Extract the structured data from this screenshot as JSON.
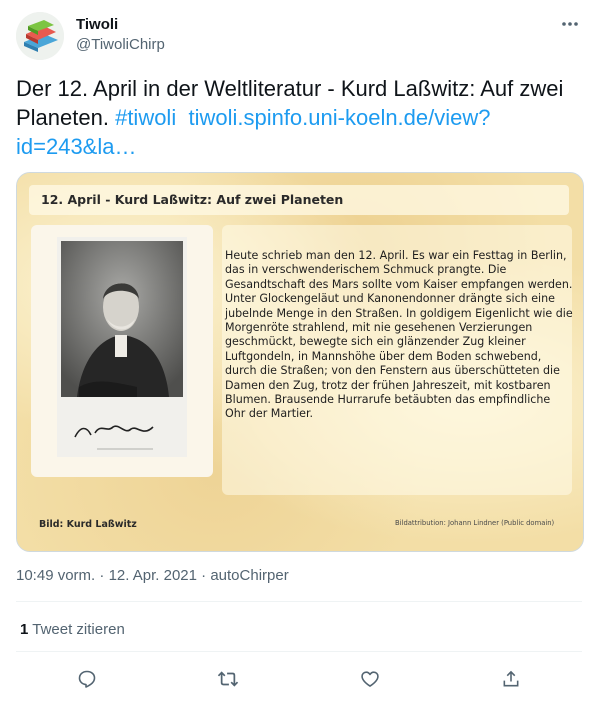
{
  "author": {
    "name": "Tiwoli",
    "handle": "@TiwoliChirp"
  },
  "tweet": {
    "text": "Der 12. April in der Weltliteratur - Kurd Laßwitz: Auf zwei Planeten. ",
    "hashtag": "#tiwoli",
    "link": "tiwoli.spinfo.uni-koeln.de/view?id=243&la…"
  },
  "media": {
    "title": "12. April - Kurd Laßwitz: Auf zwei Planeten",
    "story": "Heute schrieb man den 12. April. Es war ein Festtag in Berlin, das in verschwenderischem Schmuck prangte. Die Gesandtschaft des Mars sollte vom Kaiser empfangen werden. Unter Glockengeläut und Kanonendonner drängte sich eine jubelnde Menge in den Straßen. In goldigem Eigenlicht wie die Morgenröte strahlend, mit nie gesehenen Verzierungen geschmückt, bewegte sich ein glänzender Zug kleiner Luftgondeln, in Mannshöhe über dem Boden schwebend, durch die Straßen; von den Fenstern aus überschütteten die Damen den Zug, trotz der frühen Jahreszeit, mit kostbaren Blumen. Brausende Hurrarufe betäubten das empfindliche Ohr der Martier.",
    "signature": "Kurd Laßwitz",
    "caption_left": "Bild: Kurd Laßwitz",
    "caption_right": "Bildattribution: Johann Lindner (Public domain)"
  },
  "meta": {
    "time": "10:49 vorm.",
    "sep": " · ",
    "date": "12. Apr. 2021",
    "source": "autoChirper"
  },
  "quotes": {
    "count": "1",
    "label": "Tweet zitieren"
  },
  "icons": {
    "more": "more-icon",
    "reply": "reply-icon",
    "retweet": "retweet-icon",
    "like": "like-icon",
    "share": "share-icon"
  },
  "colors": {
    "link": "#1d9bf0",
    "secondary": "#536471",
    "parchment": "#f3dea6"
  }
}
